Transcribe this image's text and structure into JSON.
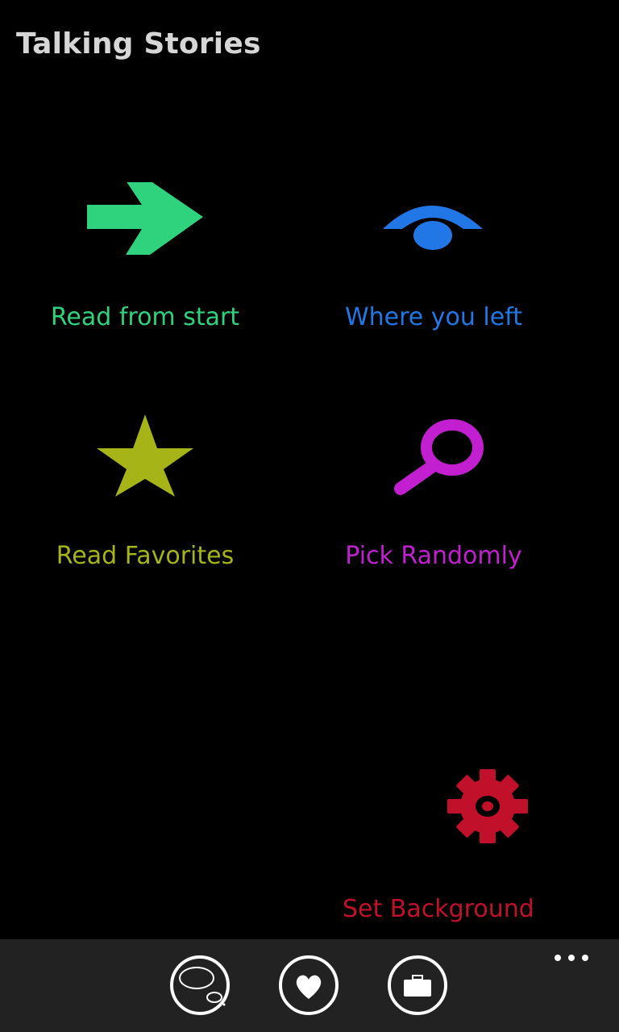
{
  "app": {
    "title": "Talking Stories"
  },
  "tiles": [
    {
      "id": "read-start",
      "label": "Read from start",
      "icon": "arrow-right-icon",
      "color": "#2fd37e"
    },
    {
      "id": "where-left",
      "label": "Where you left",
      "icon": "eye-icon",
      "color": "#2277e6"
    },
    {
      "id": "favorites",
      "label": "Read Favorites",
      "icon": "star-icon",
      "color": "#a6b417"
    },
    {
      "id": "random",
      "label": "Pick Randomly",
      "icon": "magnifier-icon",
      "color": "#c21fd0"
    },
    {
      "id": "background",
      "label": "Set Background",
      "icon": "gear-icon",
      "color": "#c0102a"
    }
  ],
  "app_bar": {
    "buttons": [
      {
        "id": "bubble",
        "icon": "speech-bubble-icon"
      },
      {
        "id": "favorite",
        "icon": "heart-icon"
      },
      {
        "id": "briefcase",
        "icon": "briefcase-icon"
      }
    ],
    "more_icon": "more-dots-icon",
    "background_color": "#222222"
  }
}
